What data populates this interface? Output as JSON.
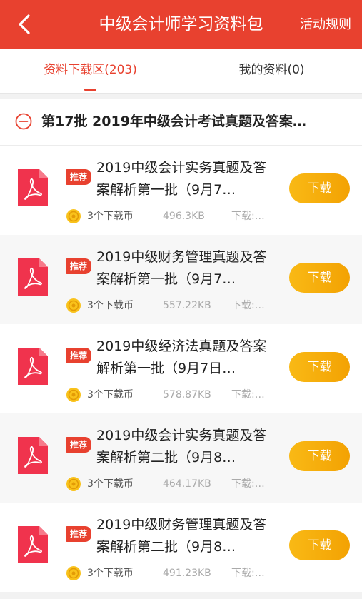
{
  "header": {
    "title": "中级会计师学习资料包",
    "rules_label": "活动规则",
    "back_icon": "chevron-left-icon"
  },
  "colors": {
    "brand_red": "#e8412f",
    "button_orange": "#f5a90a"
  },
  "tabs": [
    {
      "label": "资料下载区(203)",
      "active": true
    },
    {
      "label": "我的资料(0)",
      "active": false
    }
  ],
  "batch": {
    "icon": "minus-circle-icon",
    "title": "第17批 2019年中级会计考试真题及答案…"
  },
  "items": [
    {
      "badge": "推荐",
      "title": "2019中级会计实务真题及答案解析第一批（9月7…",
      "cost": "3个下载币",
      "size": "496.3KB",
      "downloads": "下载:…",
      "button": "下载"
    },
    {
      "badge": "推荐",
      "title": "2019中级财务管理真题及答案解析第一批（9月7…",
      "cost": "3个下载币",
      "size": "557.22KB",
      "downloads": "下载:…",
      "button": "下载"
    },
    {
      "badge": "推荐",
      "title": "2019中级经济法真题及答案解析第一批（9月7日…",
      "cost": "3个下载币",
      "size": "578.87KB",
      "downloads": "下载:…",
      "button": "下载"
    },
    {
      "badge": "推荐",
      "title": "2019中级会计实务真题及答案解析第二批（9月8…",
      "cost": "3个下载币",
      "size": "464.17KB",
      "downloads": "下载:…",
      "button": "下载"
    },
    {
      "badge": "推荐",
      "title": "2019中级财务管理真题及答案解析第二批（9月8…",
      "cost": "3个下载币",
      "size": "491.23KB",
      "downloads": "下载:…",
      "button": "下载"
    }
  ]
}
